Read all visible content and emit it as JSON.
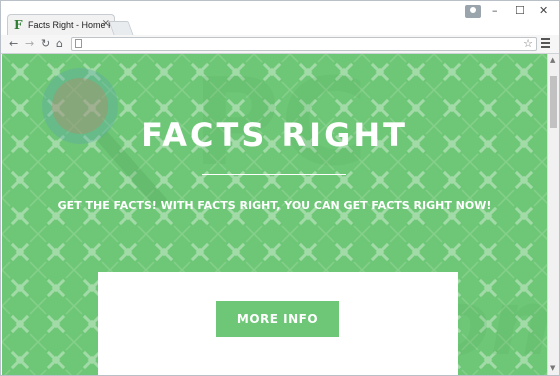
{
  "browser": {
    "tab_title": "Facts Right - Home Page",
    "tab_favicon": "F",
    "tab_close": "×",
    "window_controls": {
      "minimize": "–",
      "maximize": "☐",
      "close": "✕"
    },
    "toolbar": {
      "back": "←",
      "forward": "→",
      "reload": "↻",
      "home": "⌂",
      "star": "☆"
    },
    "address": ""
  },
  "page": {
    "title": "FACTS RIGHT",
    "subtitle": "GET THE FACTS! WITH FACTS RIGHT, YOU CAN GET FACTS RIGHT NOW!",
    "button_label": "MORE INFO"
  },
  "colors": {
    "page_green": "#6ec777",
    "white": "#ffffff"
  }
}
